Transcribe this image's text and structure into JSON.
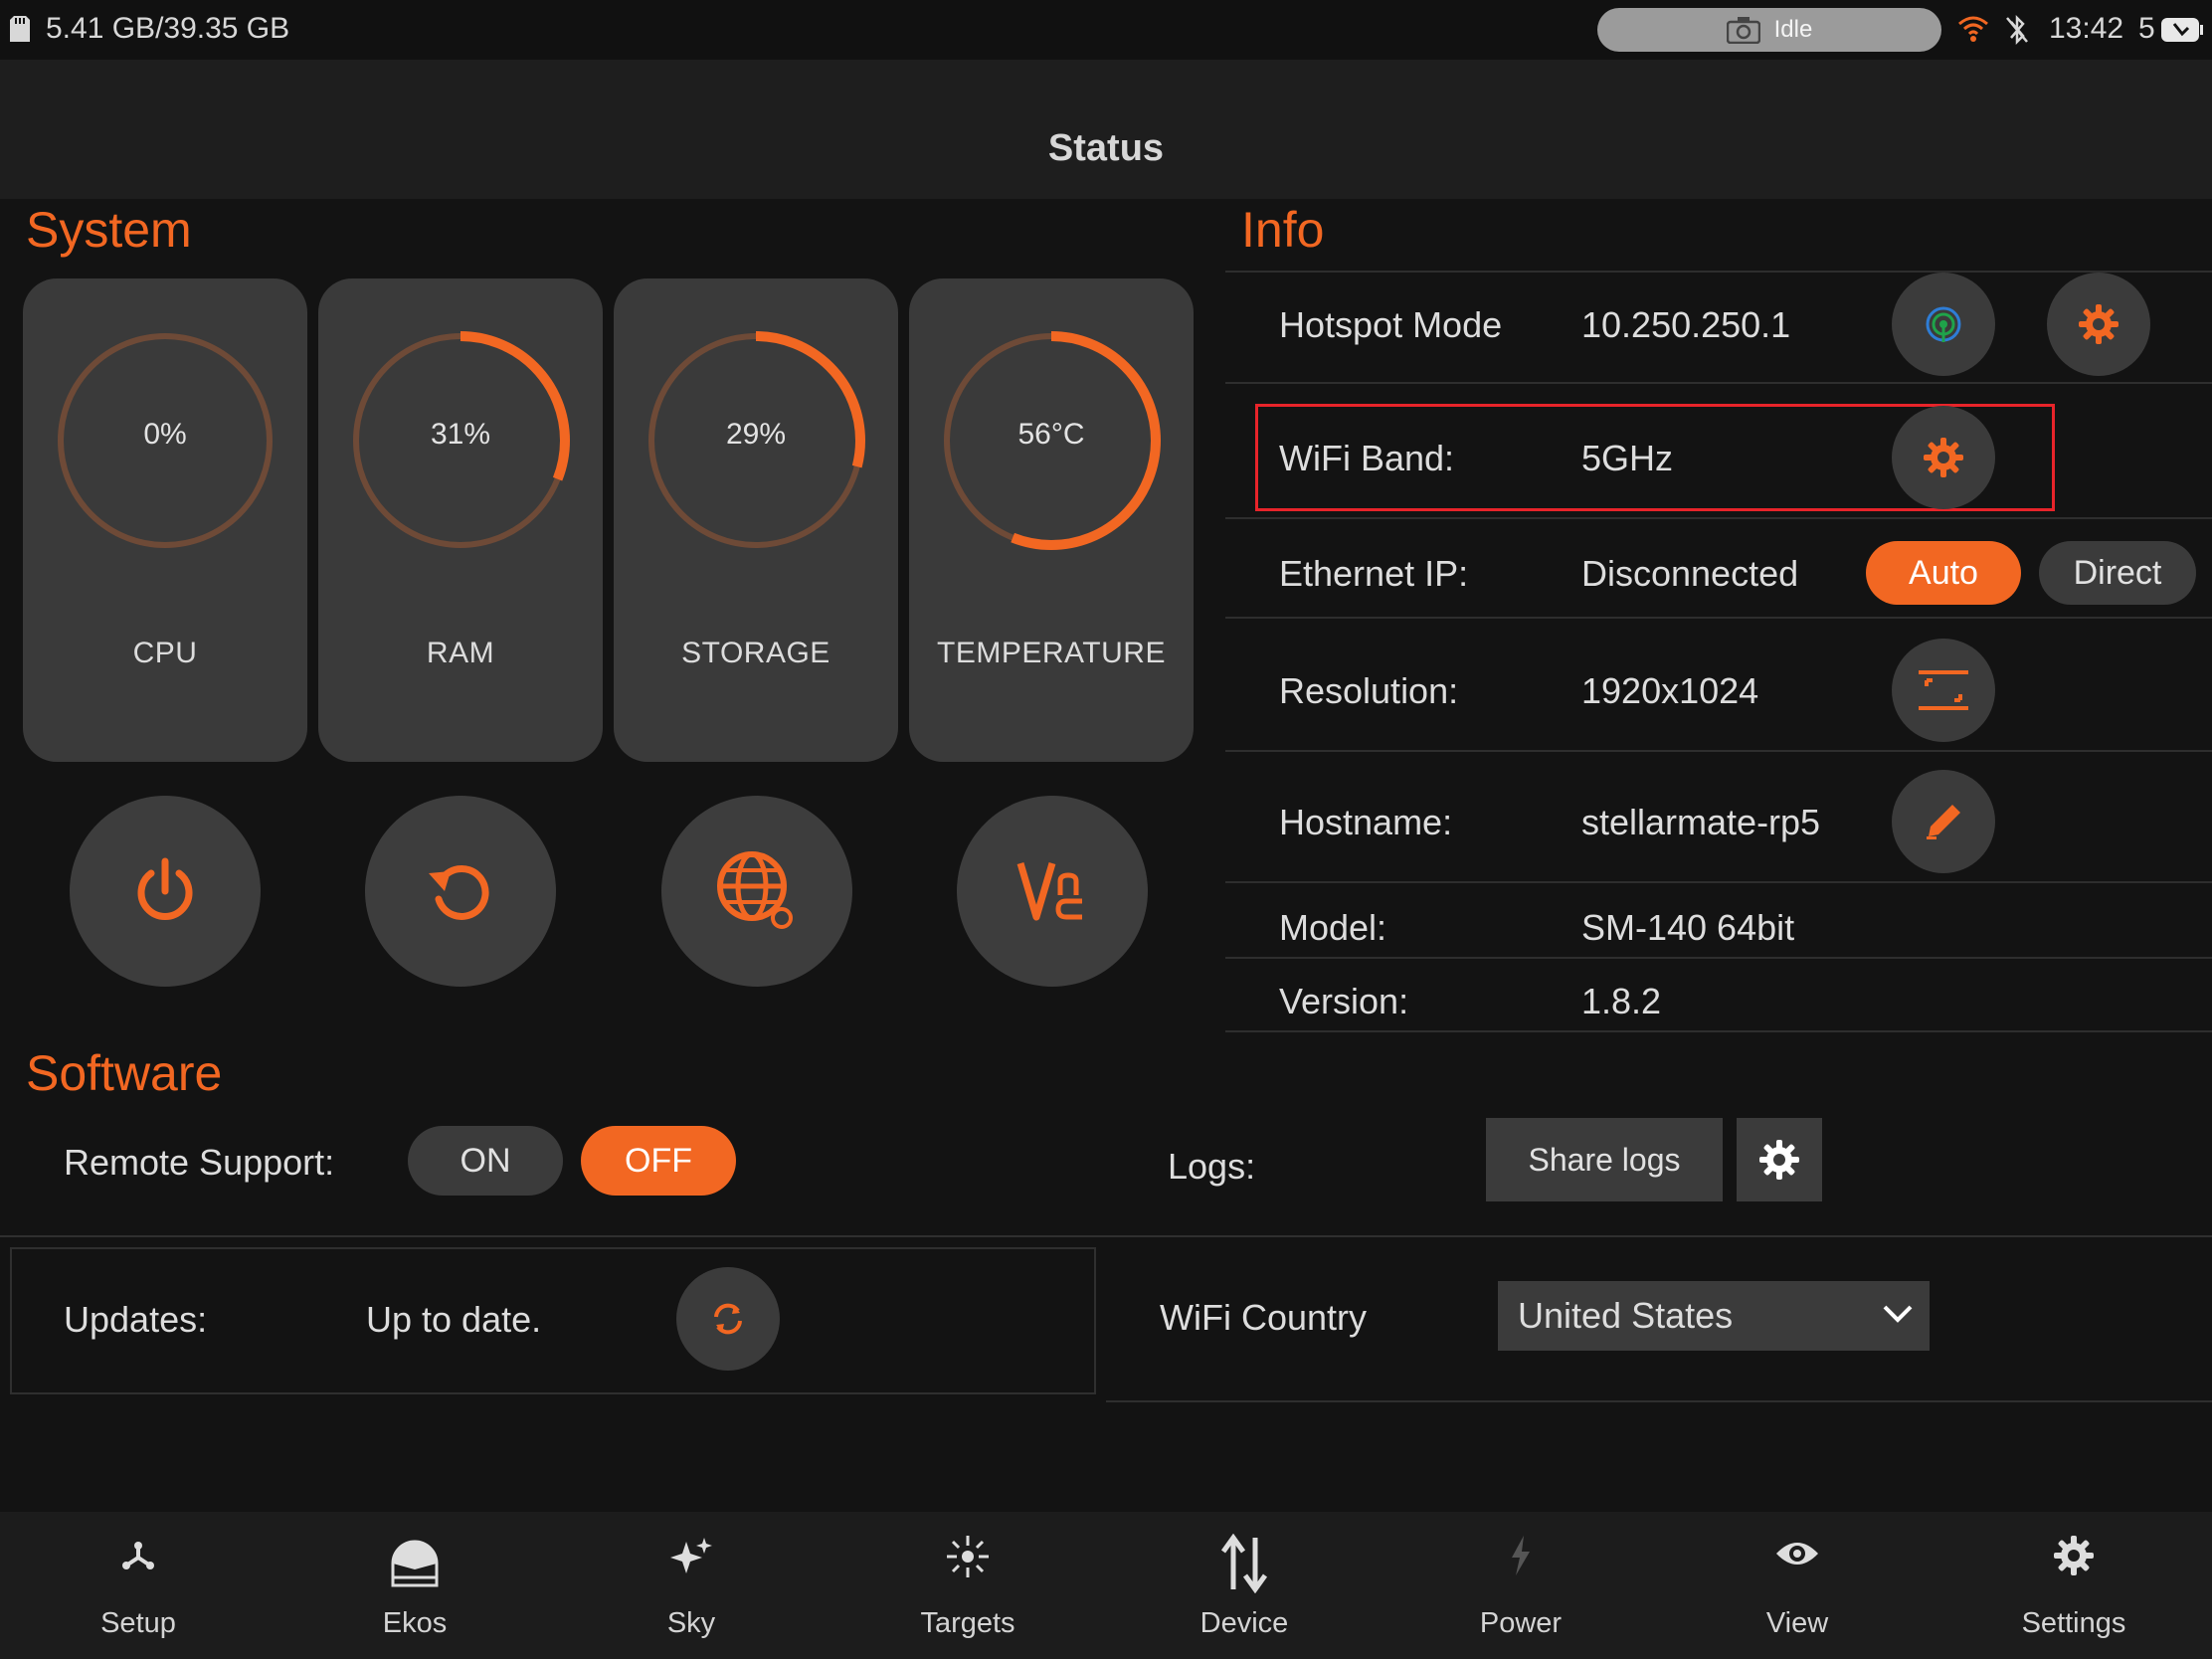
{
  "statusbar": {
    "storage": "5.41 GB/39.35 GB",
    "camera_status": "Idle",
    "time": "13:42",
    "extra": "5"
  },
  "header": {
    "title": "Status"
  },
  "system": {
    "title": "System",
    "gauges": [
      {
        "label": "CPU",
        "value": "0%",
        "fraction": 0.0
      },
      {
        "label": "RAM",
        "value": "31%",
        "fraction": 0.31
      },
      {
        "label": "STORAGE",
        "value": "29%",
        "fraction": 0.29
      },
      {
        "label": "TEMPERATURE",
        "value": "56°C",
        "fraction": 0.56
      }
    ],
    "buttons": [
      "power-icon",
      "restart-icon",
      "globe-settings-icon",
      "vnc-icon"
    ]
  },
  "info": {
    "title": "Info",
    "hotspot": {
      "label": "Hotspot Mode",
      "value": "10.250.250.1"
    },
    "wifi_band": {
      "label": "WiFi Band:",
      "value": "5GHz"
    },
    "ethernet": {
      "label": "Ethernet IP:",
      "value": "Disconnected",
      "auto_label": "Auto",
      "direct_label": "Direct"
    },
    "resolution": {
      "label": "Resolution:",
      "value": "1920x1024"
    },
    "hostname": {
      "label": "Hostname:",
      "value": "stellarmate-rp5"
    },
    "model": {
      "label": "Model:",
      "value": "SM-140 64bit"
    },
    "version": {
      "label": "Version:",
      "value": "1.8.2"
    }
  },
  "software": {
    "title": "Software",
    "remote_support": {
      "label": "Remote Support:",
      "on_label": "ON",
      "off_label": "OFF",
      "selected": "OFF"
    },
    "logs": {
      "label": "Logs:",
      "share_label": "Share logs"
    },
    "updates": {
      "label": "Updates:",
      "status": "Up to date."
    },
    "wifi_country": {
      "label": "WiFi Country",
      "selected": "United States"
    }
  },
  "nav": {
    "items": [
      {
        "label": "Setup",
        "icon": "setup-icon"
      },
      {
        "label": "Ekos",
        "icon": "ekos-icon"
      },
      {
        "label": "Sky",
        "icon": "sky-icon"
      },
      {
        "label": "Targets",
        "icon": "targets-icon"
      },
      {
        "label": "Device",
        "icon": "device-icon"
      },
      {
        "label": "Power",
        "icon": "power-icon"
      },
      {
        "label": "View",
        "icon": "view-icon"
      },
      {
        "label": "Settings",
        "icon": "settings-icon"
      }
    ]
  },
  "colors": {
    "accent": "#f26722",
    "highlight": "#e8242a",
    "card": "#3a3a3a",
    "ring_track": "#6e4a37"
  }
}
